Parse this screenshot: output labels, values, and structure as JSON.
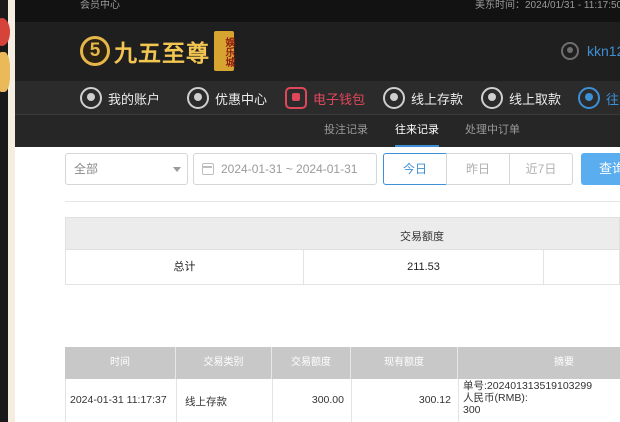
{
  "topbar": {
    "member_center": "会员中心",
    "time_label": "美东时间：2024/01/31 - 11:17:50"
  },
  "header": {
    "logo_mark": "5",
    "logo_text": "九五至尊",
    "logo_seal": "娱乐城",
    "username": "kkn12"
  },
  "main_nav": [
    {
      "label": "我的账户",
      "icon": "user-circle-icon"
    },
    {
      "label": "优惠中心",
      "icon": "gift-icon"
    },
    {
      "label": "电子钱包",
      "icon": "wallet-icon"
    },
    {
      "label": "线上存款",
      "icon": "deposit-icon"
    },
    {
      "label": "线上取款",
      "icon": "withdraw-icon"
    },
    {
      "label": "往",
      "icon": "history-icon"
    }
  ],
  "sub_nav": [
    {
      "label": "投注记录"
    },
    {
      "label": "往来记录"
    },
    {
      "label": "处理中订单"
    }
  ],
  "filters": {
    "category_value": "全部",
    "date_range": "2024-01-31 ~ 2024-01-31",
    "today": "今日",
    "yesterday": "昨日",
    "last7": "近7日",
    "query": "查询"
  },
  "summary": {
    "header": "交易额度",
    "total_label": "总计",
    "total_value": "211.53"
  },
  "transactions": {
    "columns": [
      "时间",
      "交易类别",
      "交易额度",
      "现有额度",
      "摘要"
    ],
    "rows": [
      {
        "time": "2024-01-31 11:17:37",
        "type": "线上存款",
        "amount": "300.00",
        "balance": "300.12",
        "summary_line1": "单号:202401313519103299",
        "summary_line2": "人民币(RMB):",
        "summary_line3": "300"
      }
    ]
  },
  "colors": {
    "accent_blue": "#3d8fd6",
    "active_red": "#e0475a",
    "gold": "#f3c652"
  }
}
